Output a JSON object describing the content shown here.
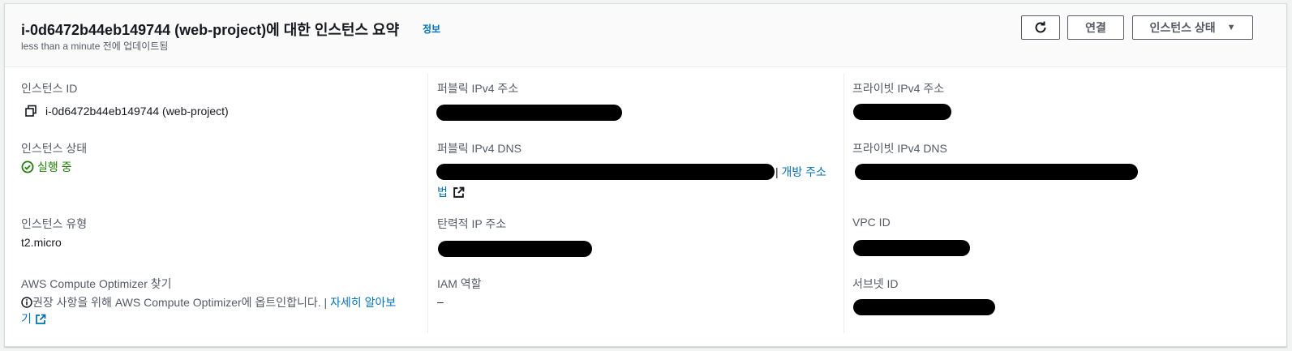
{
  "header": {
    "title": "i-0d6472b44eb149744 (web-project)에 대한 인스턴스 요약",
    "info_label": "정보",
    "updated_text": "less than a minute 전에 업데이트됨",
    "connect_label": "연결",
    "instance_state_label": "인스턴스 상태"
  },
  "details": {
    "instance_id_label": "인스턴스 ID",
    "instance_id_value": "i-0d6472b44eb149744 (web-project)",
    "public_ipv4_label": "퍼블릭 IPv4 주소",
    "private_ipv4_label": "프라이빗 IPv4 주소",
    "instance_state_label": "인스턴스 상태",
    "instance_state_value": "실행 중",
    "public_dns_label": "퍼블릭 IPv4 DNS",
    "open_address_label_1": "개방 주소",
    "open_address_label_2": "법",
    "private_dns_label": "프라이빗 IPv4 DNS",
    "instance_type_label": "인스턴스 유형",
    "instance_type_value": "t2.micro",
    "elastic_ip_label": "탄력적 IP 주소",
    "vpc_id_label": "VPC ID",
    "optimizer_label": "AWS Compute Optimizer 찾기",
    "optimizer_text": "권장 사항을 위해 AWS Compute Optimizer에 옵트인합니다. |",
    "learn_more_1": "자세히 알아보",
    "learn_more_2": "기",
    "iam_role_label": "IAM 역할",
    "iam_role_value": "–",
    "subnet_id_label": "서브넷 ID"
  },
  "colors": {
    "link": "#0073bb",
    "running": "#1d8102",
    "label": "#545b64"
  }
}
